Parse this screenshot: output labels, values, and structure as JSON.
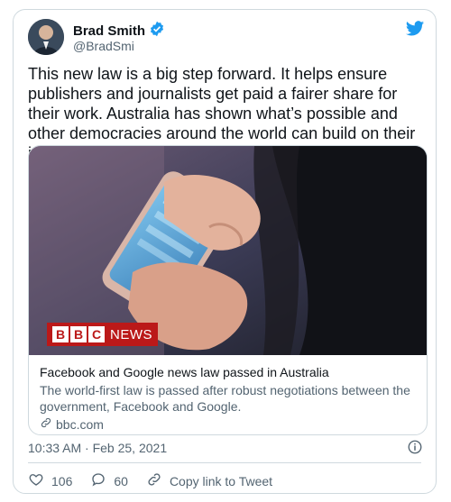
{
  "user": {
    "name": "Brad Smith",
    "handle": "@BradSmi"
  },
  "tweet": {
    "text": "This new law is a big step forward. It helps ensure publishers and journalists get paid a fairer share for their work. Australia has shown what’s possible and other democracies around the world can build on their ideas."
  },
  "link_card": {
    "brand_letters": [
      "B",
      "B",
      "C"
    ],
    "brand_word": "NEWS",
    "title": "Facebook and Google news law passed in Australia",
    "description": "The world-first law is passed after robust negotiations between the government, Facebook and Google.",
    "domain": "bbc.com"
  },
  "meta": {
    "timestamp": "10:33 AM · Feb 25, 2021"
  },
  "actions": {
    "likes": "106",
    "replies": "60",
    "copy_link": "Copy link to Tweet"
  },
  "colors": {
    "twitter_blue": "#1d9bf0",
    "bbc_red": "#bb1919",
    "text_secondary": "#536471"
  }
}
